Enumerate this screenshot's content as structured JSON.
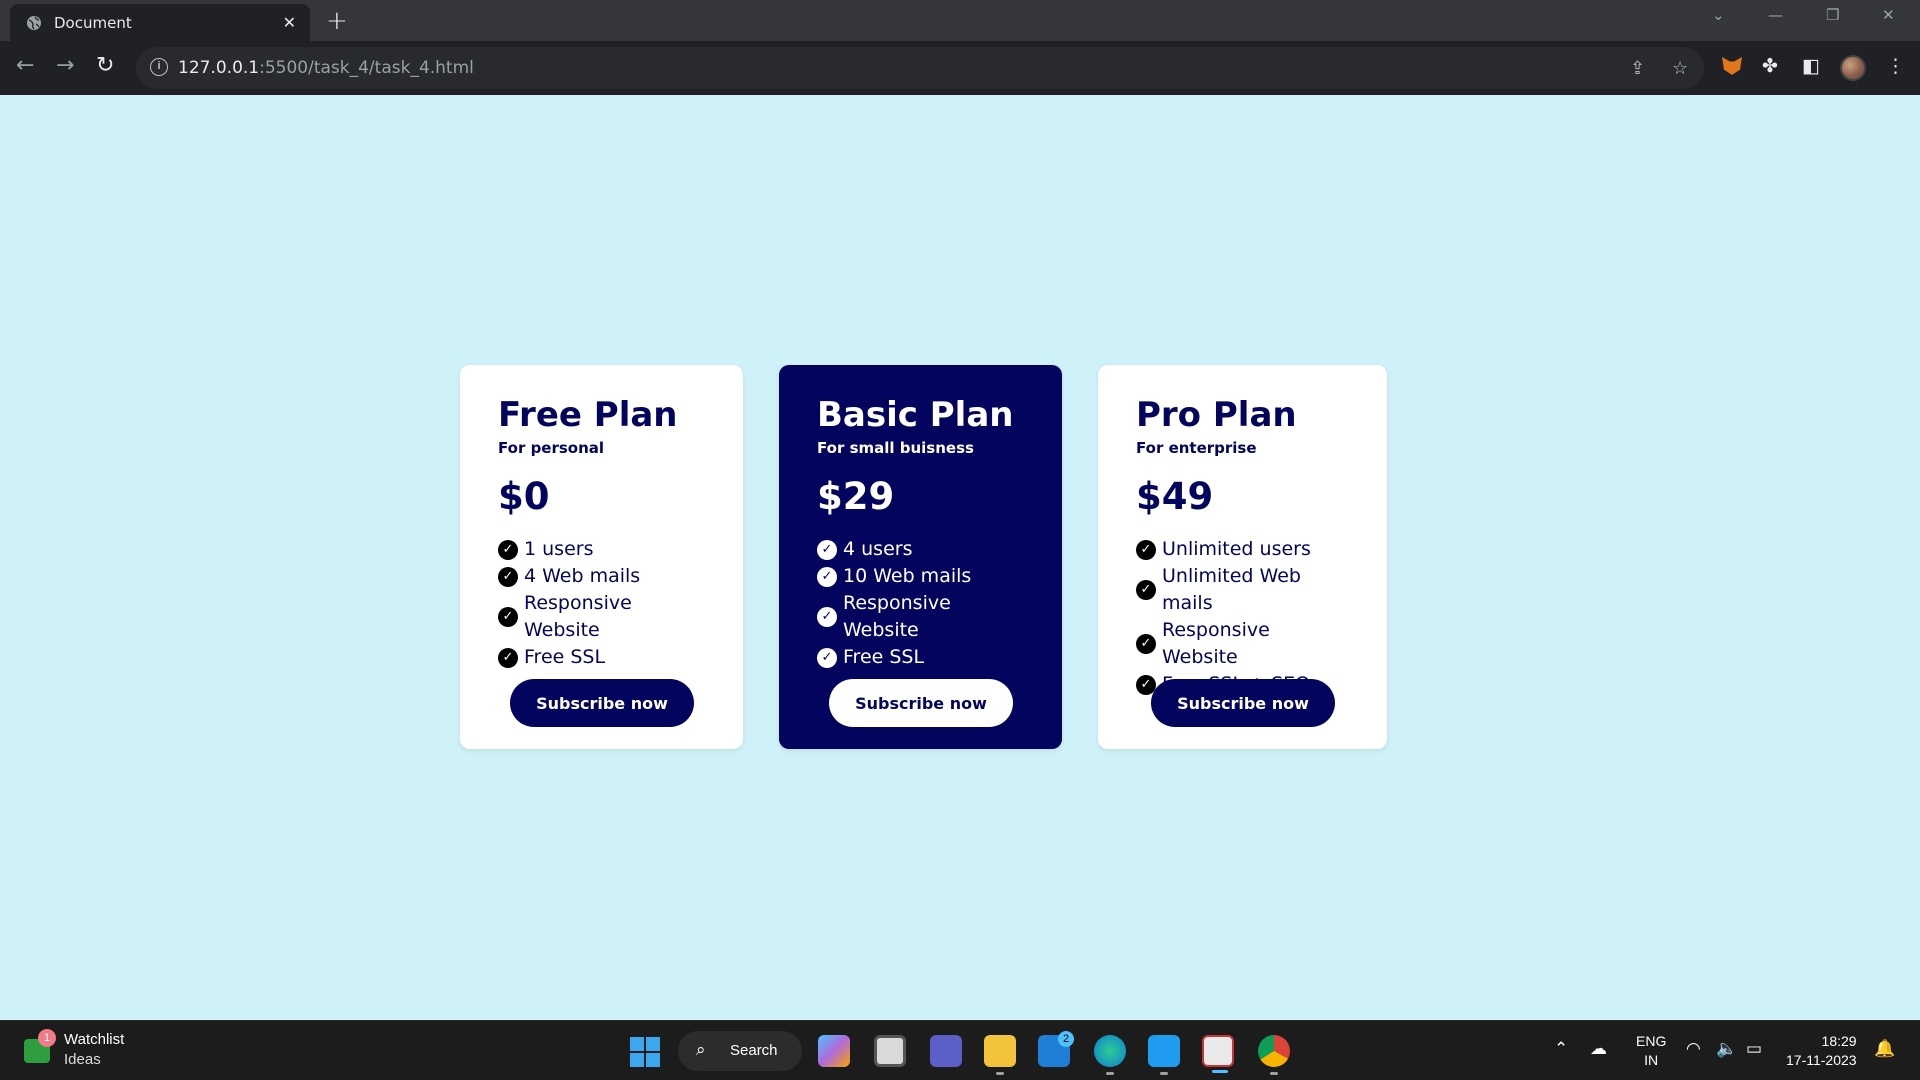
{
  "browser": {
    "tab_title": "Document",
    "tab_close": "✕",
    "new_tab": "+",
    "url_host": "127.0.0.1",
    "url_path": ":5500/task_4/task_4.html",
    "back": "←",
    "forward": "→",
    "reload": "↻",
    "share": "⇪",
    "star": "☆",
    "extensions": "✤",
    "sidepanel": "◧",
    "menu": "⋮",
    "win_dropdown": "⌄",
    "win_minimize": "—",
    "win_restore": "❐",
    "win_close": "✕"
  },
  "plans": [
    {
      "title": "Free Plan",
      "subtitle": "For personal",
      "price": "$0",
      "features": [
        "1 users",
        "4 Web mails",
        "Responsive Website",
        "Free SSL"
      ],
      "button": "Subscribe now"
    },
    {
      "title": "Basic Plan",
      "subtitle": "For small buisness",
      "price": "$29",
      "features": [
        "4 users",
        "10 Web mails",
        "Responsive Website",
        "Free SSL"
      ],
      "button": "Subscribe now"
    },
    {
      "title": "Pro Plan",
      "subtitle": "For enterprise",
      "price": "$49",
      "features": [
        "Unlimited users",
        "Unlimited Web mails",
        "Responsive Website",
        "Free SSL + SEO"
      ],
      "button": "Subscribe now"
    }
  ],
  "colors": {
    "page_bg": "#cff1f8",
    "navy": "#03045e",
    "card_bg": "#ffffff"
  },
  "taskbar": {
    "widget_title": "Watchlist",
    "widget_sub": "Ideas",
    "widget_badge": "1",
    "search_label": "Search",
    "mail_badge": "2",
    "lang_line1": "ENG",
    "lang_line2": "IN",
    "time": "18:29",
    "date": "17-11-2023"
  }
}
